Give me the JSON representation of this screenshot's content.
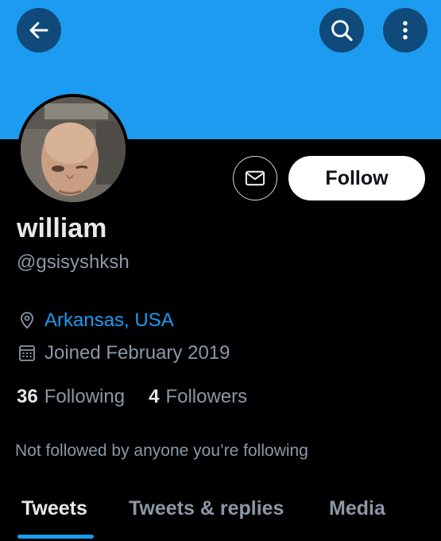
{
  "header": {
    "back_icon": "arrow-left-icon",
    "search_icon": "search-icon",
    "more_icon": "more-vertical-icon",
    "banner_color": "#1d9bf0"
  },
  "profile": {
    "name": "william",
    "handle": "@gsisyshksh",
    "location": "Arkansas, USA",
    "joined": "Joined February 2019",
    "following_count": "36",
    "following_label": "Following",
    "followers_count": "4",
    "followers_label": "Followers",
    "not_followed_text": "Not followed by anyone you’re following"
  },
  "actions": {
    "message_icon": "envelope-icon",
    "follow_label": "Follow"
  },
  "tabs": [
    {
      "label": "Tweets",
      "active": true
    },
    {
      "label": "Tweets & replies",
      "active": false
    },
    {
      "label": "Media",
      "active": false
    }
  ],
  "colors": {
    "accent": "#1d9bf0",
    "background": "#000000",
    "secondary_text": "#8b98a5"
  }
}
